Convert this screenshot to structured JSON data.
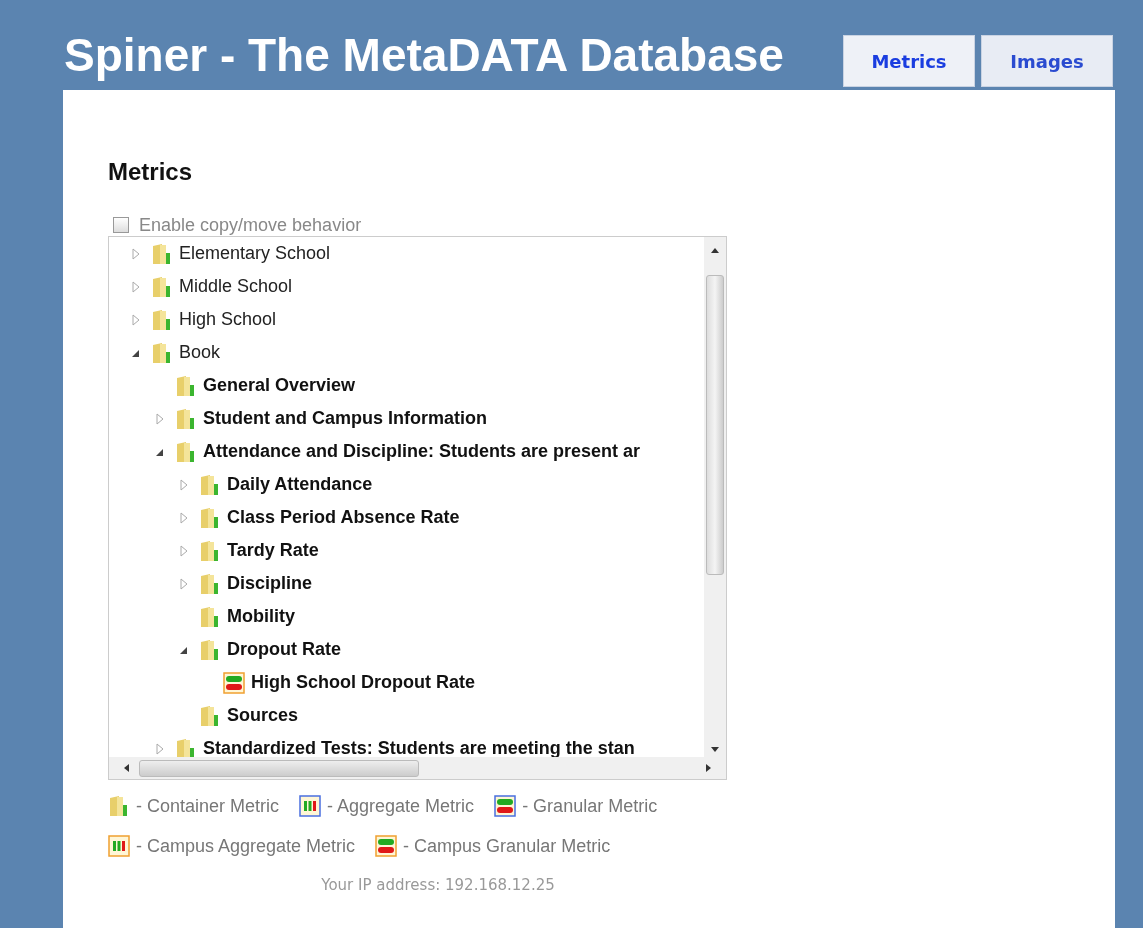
{
  "header": {
    "title": "Spiner - The MetaDATA Database"
  },
  "tabs": [
    {
      "label": "Metrics",
      "selected": true
    },
    {
      "label": "Images",
      "selected": false
    }
  ],
  "section_title": "Metrics",
  "copy_move": {
    "label": "Enable copy/move behavior",
    "checked": false
  },
  "tree": [
    {
      "label": "Elementary School",
      "kind": "container",
      "expanded": false
    },
    {
      "label": "Middle School",
      "kind": "container",
      "expanded": false
    },
    {
      "label": "High School",
      "kind": "container",
      "expanded": false
    },
    {
      "label": "Book",
      "kind": "container",
      "expanded": true,
      "children": [
        {
          "label": "General Overview",
          "kind": "container"
        },
        {
          "label": "Student and Campus Information",
          "kind": "container",
          "expanded": false
        },
        {
          "label": "Attendance and Discipline: Students are present ar",
          "kind": "container",
          "expanded": true,
          "children": [
            {
              "label": "Daily Attendance",
              "kind": "container",
              "expanded": false
            },
            {
              "label": "Class Period Absence Rate",
              "kind": "container",
              "expanded": false
            },
            {
              "label": "Tardy Rate",
              "kind": "container",
              "expanded": false
            },
            {
              "label": "Discipline",
              "kind": "container",
              "expanded": false
            },
            {
              "label": "Mobility",
              "kind": "container"
            },
            {
              "label": "Dropout Rate",
              "kind": "container",
              "expanded": true,
              "children": [
                {
                  "label": "High School Dropout Rate",
                  "kind": "campus_granular"
                }
              ]
            },
            {
              "label": "Sources",
              "kind": "container"
            }
          ]
        },
        {
          "label": "Standardized Tests: Students are meeting the stan",
          "kind": "container",
          "expanded": false
        }
      ]
    }
  ],
  "legend": [
    [
      {
        "kind": "container",
        "label": "- Container Metric"
      },
      {
        "kind": "aggregate",
        "label": "- Aggregate Metric"
      },
      {
        "kind": "granular",
        "label": "- Granular Metric"
      }
    ],
    [
      {
        "kind": "campus_aggregate",
        "label": "- Campus Aggregate Metric"
      },
      {
        "kind": "campus_granular",
        "label": "- Campus Granular Metric"
      }
    ]
  ],
  "footer": "Your IP address: 192.168.12.25"
}
